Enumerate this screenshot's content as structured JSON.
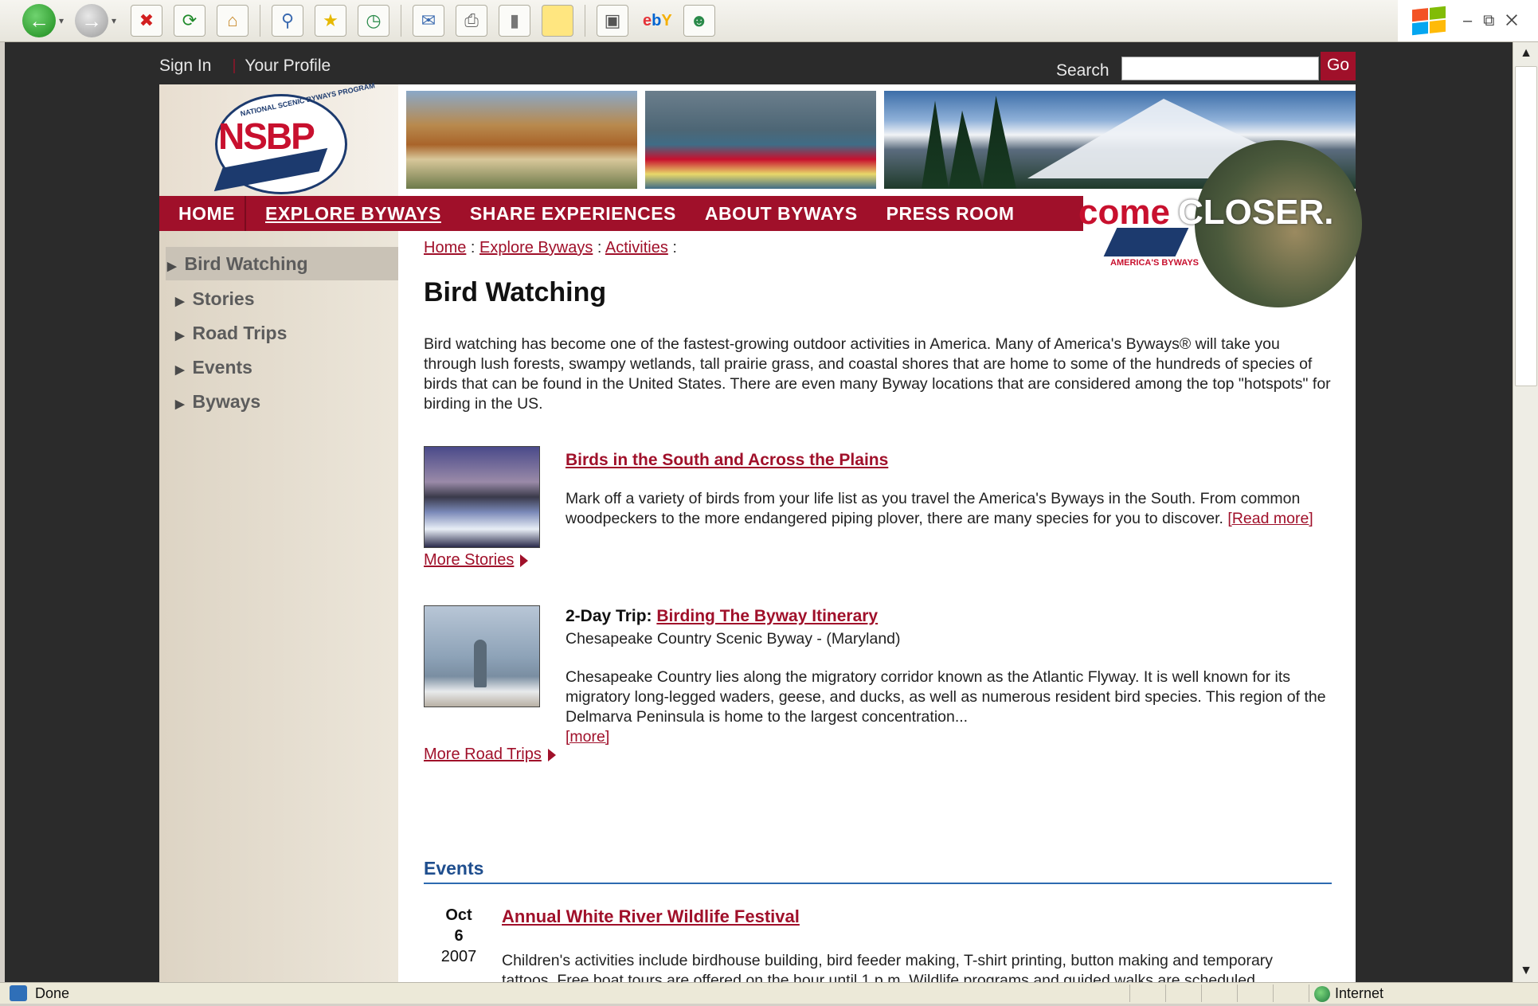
{
  "browser": {
    "toolbar_icons": [
      "back-icon",
      "forward-icon",
      "stop-icon",
      "refresh-icon",
      "home-icon",
      "search-icon",
      "favorites-icon",
      "history-icon",
      "mail-icon",
      "print-icon",
      "edit-icon",
      "notes-icon",
      "research-icon",
      "ebay-icon",
      "messenger-icon"
    ],
    "ebay_label": {
      "e": "e",
      "b": "b",
      "y": "Y"
    },
    "status": "Done",
    "zone": "Internet"
  },
  "topbar": {
    "sign_in": "Sign In",
    "your_profile": "Your Profile",
    "search_label": "Search",
    "search_value": "",
    "go_label": "Go"
  },
  "header": {
    "logo_text": "NSBP",
    "logo_arc": "NATIONAL SCENIC BYWAYS PROGRAM",
    "tagline_come": "come",
    "tagline_closer": "CLOSER.",
    "badge": "AMERICA'S BYWAYS"
  },
  "nav": {
    "items": [
      {
        "label": "HOME",
        "active": false
      },
      {
        "label": "EXPLORE BYWAYS",
        "active": true
      },
      {
        "label": "SHARE EXPERIENCES",
        "active": false
      },
      {
        "label": "ABOUT BYWAYS",
        "active": false
      },
      {
        "label": "PRESS ROOM",
        "active": false
      }
    ]
  },
  "sidebar": {
    "items": [
      {
        "label": "Bird Watching",
        "active": true
      },
      {
        "label": "Stories"
      },
      {
        "label": "Road Trips"
      },
      {
        "label": "Events"
      },
      {
        "label": "Byways"
      }
    ]
  },
  "breadcrumb": {
    "home": "Home",
    "explore": "Explore Byways",
    "activities": "Activities",
    "sep": ":"
  },
  "page": {
    "title": "Bird Watching",
    "intro": "Bird watching has become one of the fastest-growing outdoor activities in America. Many of America's Byways® will take you through lush forests, swampy wetlands, tall prairie grass, and coastal shores that are home to some of the hundreds of species of birds that can be found in the United States. There are even many Byway locations that are considered among the top \"hotspots\" for birding in the US."
  },
  "story": {
    "title": "Birds in the South and Across the Plains",
    "body": "Mark off a variety of birds from your life list as you travel the America's Byways in the South. From common woodpeckers to the more endangered piping plover, there are many species for you to discover.",
    "read_more": "[Read more]",
    "more_stories": "More Stories"
  },
  "trip": {
    "label": "2-Day Trip:",
    "title": "Birding The Byway Itinerary",
    "subtitle": "Chesapeake Country Scenic Byway - (Maryland)",
    "body": "Chesapeake Country lies along the migratory corridor known as the Atlantic Flyway. It is well known for its migratory long-legged waders, geese, and ducks, as well as numerous resident bird species. This region of the Delmarva Peninsula is home to the largest concentration...",
    "more": "[more]",
    "more_road_trips": "More Road Trips"
  },
  "events": {
    "heading": "Events",
    "items": [
      {
        "month": "Oct",
        "day": "6",
        "year": "2007",
        "title": "Annual White River Wildlife Festival",
        "body": "Children's activities include birdhouse building, bird feeder making, T-shirt printing, button making and temporary tattoos. Free boat tours are offered on the hour until 1 p.m. Wildlife programs and guided walks are scheduled throughout the day."
      }
    ]
  }
}
